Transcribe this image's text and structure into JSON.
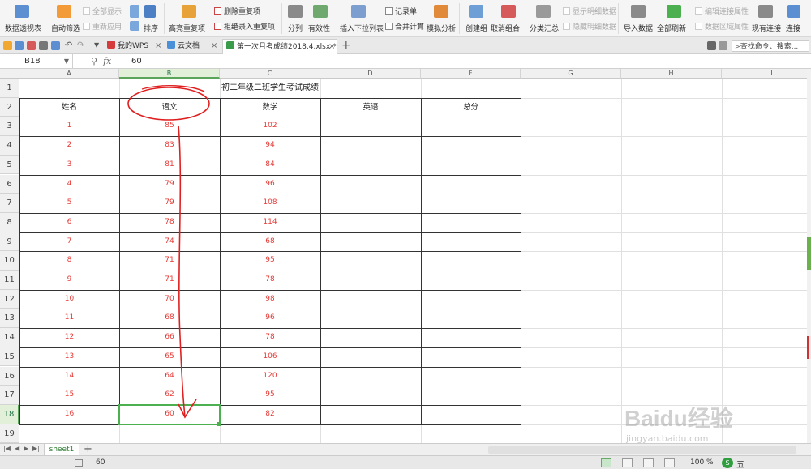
{
  "ribbon": {
    "pivot": "数据透视表",
    "autofilter": "自动筛选",
    "show_all": "全部显示",
    "reapply": "重新应用",
    "sort": "排序",
    "highlight_dup": "高亮重复项",
    "delete_dup": "删除重复项",
    "reject_dup": "拒绝录入重复项",
    "split": "分列",
    "validity": "有效性",
    "insert_dropdown": "插入下拉列表",
    "record": "记录单",
    "merge_calc": "合并计算",
    "simulate": "模拟分析",
    "create_group": "创建组",
    "ungroup": "取消组合",
    "subtotal": "分类汇总",
    "show_detail": "显示明细数据",
    "hide_detail": "隐藏明细数据",
    "import": "导入数据",
    "refresh_all": "全部刷新",
    "edit_link": "编辑连接属性",
    "data_region": "数据区域属性",
    "existing_conn": "现有连接",
    "conn": "连接"
  },
  "tabs": {
    "wps": "我的WPS",
    "cloud": "云文档",
    "file": "第一次月考成绩2018.4.xlsx *",
    "search": "查找命令、搜索..."
  },
  "formula": {
    "cell_ref": "B18",
    "fx": "fx",
    "value": "60"
  },
  "columns": [
    "A",
    "B",
    "C",
    "D",
    "E",
    "G",
    "H",
    "I"
  ],
  "row_numbers": [
    "1",
    "2",
    "3",
    "4",
    "5",
    "6",
    "7",
    "8",
    "9",
    "10",
    "11",
    "12",
    "13",
    "14",
    "15",
    "16",
    "17",
    "18",
    "19"
  ],
  "sheet": {
    "title": "初二年级二班学生考试成绩",
    "headers": [
      "姓名",
      "语文",
      "数学",
      "英语",
      "总分"
    ],
    "rows": [
      [
        "1",
        "85",
        "102"
      ],
      [
        "2",
        "83",
        "94"
      ],
      [
        "3",
        "81",
        "84"
      ],
      [
        "4",
        "79",
        "96"
      ],
      [
        "5",
        "79",
        "108"
      ],
      [
        "6",
        "78",
        "114"
      ],
      [
        "7",
        "74",
        "68"
      ],
      [
        "8",
        "71",
        "95"
      ],
      [
        "9",
        "71",
        "78"
      ],
      [
        "10",
        "70",
        "98"
      ],
      [
        "11",
        "68",
        "96"
      ],
      [
        "12",
        "66",
        "78"
      ],
      [
        "13",
        "65",
        "106"
      ],
      [
        "14",
        "64",
        "120"
      ],
      [
        "15",
        "62",
        "95"
      ],
      [
        "16",
        "60",
        "82"
      ]
    ]
  },
  "sheet_tabs": {
    "active": "sheet1",
    "add": "+"
  },
  "status": {
    "value": "60",
    "zoom": "100 %",
    "ime": "五"
  },
  "watermark": {
    "main": "Baidu经验",
    "sub": "jingyan.baidu.com"
  },
  "colors": {
    "accent": "#4caf50",
    "data_red": "#e53935",
    "annotation_red": "#e02020"
  }
}
